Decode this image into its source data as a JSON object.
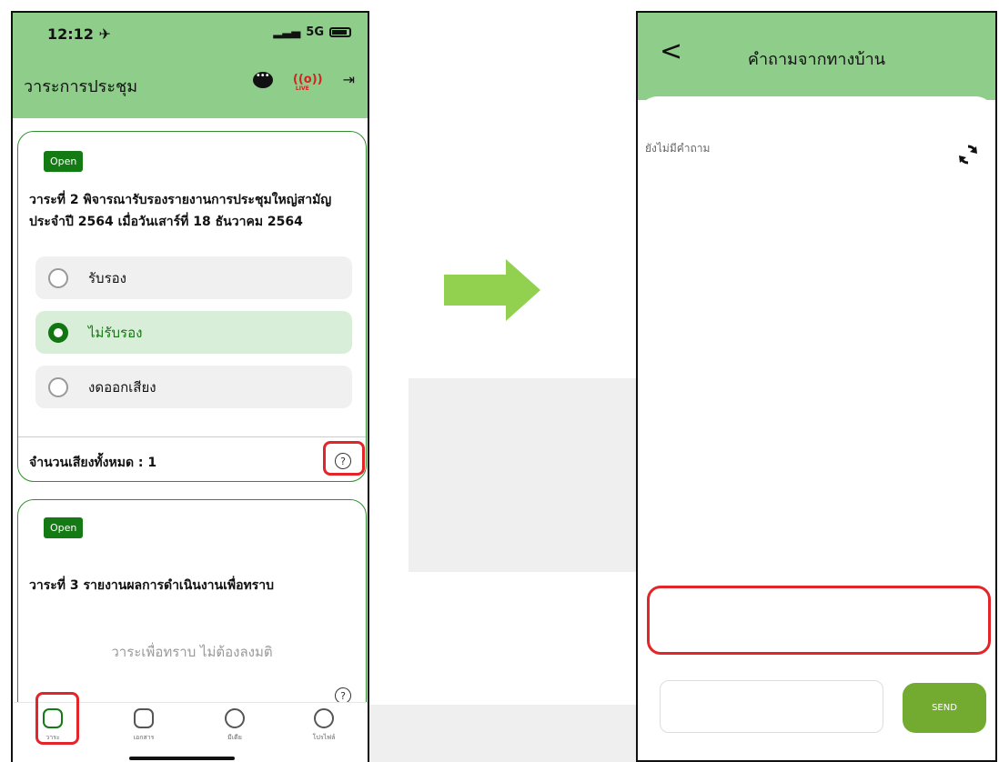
{
  "left_screen": {
    "status_bar": {
      "time": "12:12 ✈",
      "network": "5G"
    },
    "header": {
      "title": "วาระการประชุม"
    },
    "agenda_1": {
      "badge": "Open",
      "title": "วาระที่ 2 พิจารณารับรองรายงานการประชุมใหญ่สามัญประจำปี 2564 เมื่อวันเสาร์ที่ 18 ธันวาคม 2564",
      "options": [
        {
          "label": "รับรอง",
          "selected": false
        },
        {
          "label": "ไม่รับรอง",
          "selected": true
        },
        {
          "label": "งดออกเสียง",
          "selected": false
        }
      ],
      "vote_total": "จำนวนเสียงทั้งหมด : 1",
      "help": "?"
    },
    "agenda_2": {
      "badge": "Open",
      "title": "วาระที่ 3 รายงานผลการดำเนินงานเพื่อทราบ",
      "note": "วาระเพื่อทราบ ไม่ต้องลงมติ",
      "help": "?"
    },
    "tabs": [
      {
        "label": "วาระ",
        "icon": "agenda-icon",
        "active": true
      },
      {
        "label": "เอกสาร",
        "icon": "document-icon",
        "active": false
      },
      {
        "label": "มีเดีย",
        "icon": "media-play-icon",
        "active": false
      },
      {
        "label": "โปรไฟล์",
        "icon": "profile-icon",
        "active": false
      }
    ]
  },
  "right_screen": {
    "header": {
      "title": "คำถามจากทางบ้าน",
      "back": "<"
    },
    "empty_state": "ยังไม่มีคำถาม",
    "composer": {
      "placeholder": "",
      "send_label": "SEND"
    }
  },
  "colors": {
    "header_green": "#8fcd8b",
    "primary_green": "#137a14",
    "send_green": "#72ab30",
    "highlight_red": "#e3252a",
    "arrow_green": "#92d050"
  }
}
